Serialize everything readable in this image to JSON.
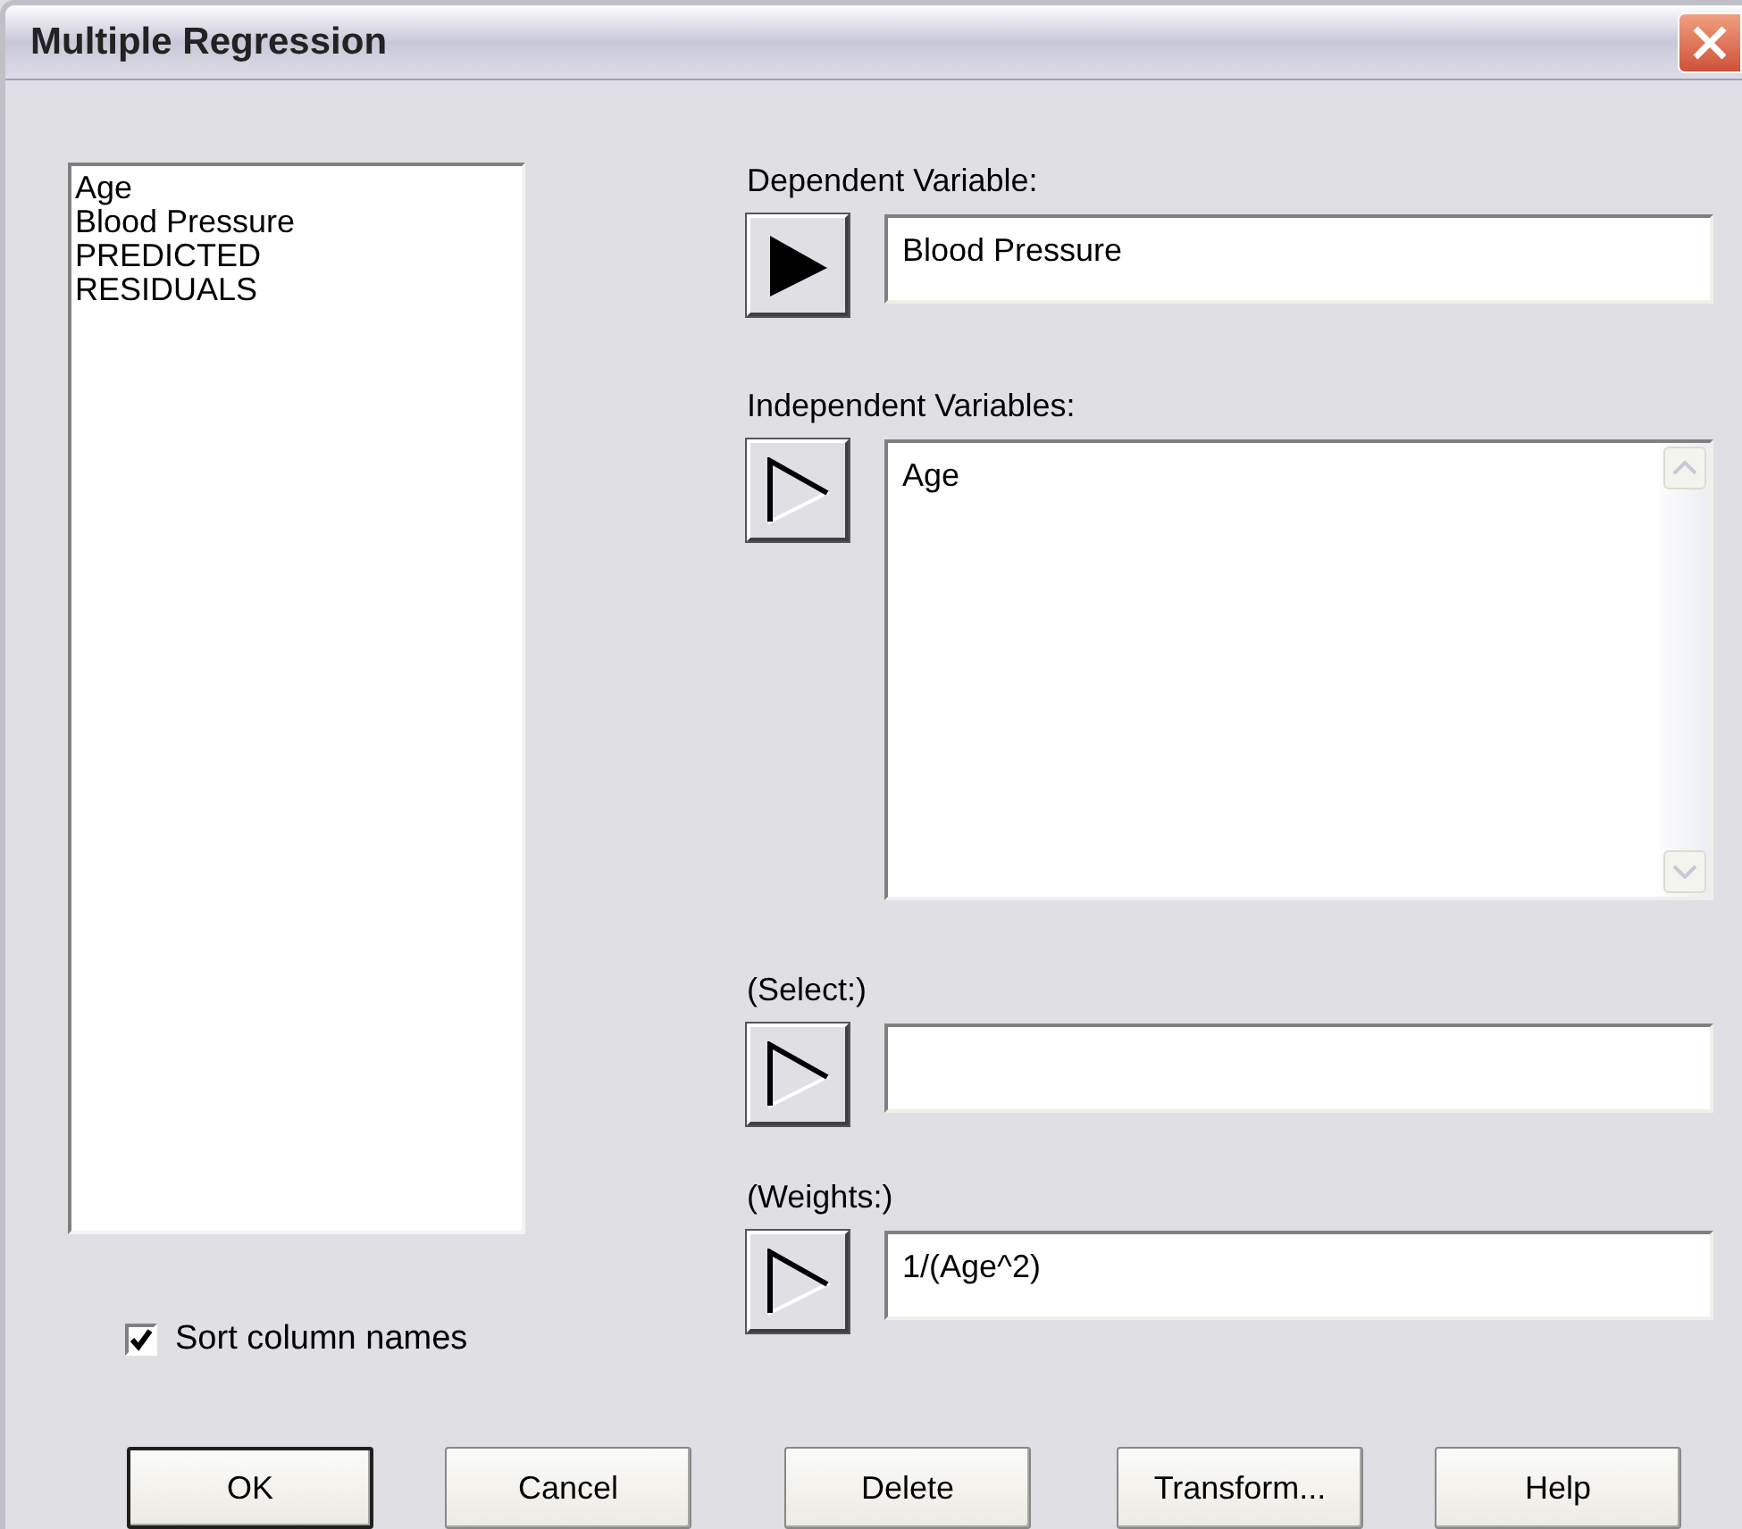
{
  "window": {
    "title": "Multiple Regression"
  },
  "columns": {
    "items": [
      "Age",
      "Blood Pressure",
      "PREDICTED",
      "RESIDUALS"
    ]
  },
  "sort_checkbox": {
    "label": "Sort column names",
    "checked": true
  },
  "fields": [
    {
      "kind": "single",
      "label": "Dependent Variable:",
      "value": "Blood Pressure",
      "arrow_disabled": false
    },
    {
      "kind": "list",
      "label": "Independent Variables:",
      "value": "Age",
      "arrow_disabled": true
    },
    {
      "kind": "single",
      "label": "(Select:)",
      "arrow_disabled": true
    },
    {
      "kind": "single",
      "label": "(Weights:)",
      "value": "1/(Age^2)",
      "arrow_disabled": true
    }
  ],
  "buttons": [
    {
      "label": "OK",
      "default": true
    },
    {
      "label": "Cancel",
      "default": false
    },
    {
      "label": "Delete",
      "default": false
    },
    {
      "label": "Transform...",
      "default": false
    },
    {
      "label": "Help",
      "default": false
    }
  ]
}
